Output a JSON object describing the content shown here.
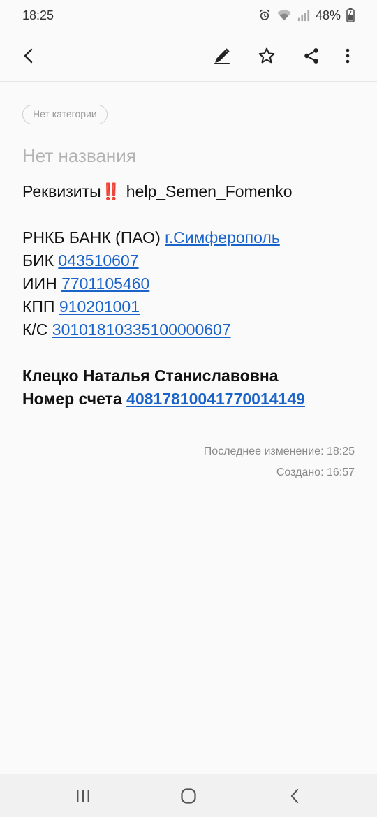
{
  "status_bar": {
    "time": "18:25",
    "battery_percent": "48%",
    "icons": [
      "alarm-icon",
      "wifi-icon",
      "signal-icon",
      "battery-charging-icon"
    ]
  },
  "toolbar": {
    "icons": [
      "back-arrow-icon",
      "pencil-icon",
      "star-icon",
      "share-icon",
      "more-vertical-icon"
    ]
  },
  "note": {
    "category": "Нет категории",
    "title": "Нет названия",
    "line1_prefix": "Реквизиты",
    "line1_emoji": "‼️",
    "line1_suffix": " help_Semen_Fomenko",
    "bank_prefix": "РНКБ БАНК (ПАО) ",
    "bank_city": "г.Симферополь",
    "bik_label": "БИК ",
    "bik_value": "043510607",
    "inn_label": "ИИН ",
    "inn_value": "7701105460",
    "kpp_label": "КПП ",
    "kpp_value": "910201001",
    "ks_label": "К/С ",
    "ks_value": "30101810335100000607",
    "holder": "Клецко Наталья Станиславовна",
    "account_label": "Номер счета ",
    "account_value": "40817810041770014149"
  },
  "meta": {
    "modified": "Последнее изменение: 18:25",
    "created": "Создано: 16:57"
  },
  "nav_bar": {
    "icons": [
      "recent-apps-icon",
      "home-icon",
      "back-icon"
    ]
  },
  "colors": {
    "link": "#1a63c9",
    "background": "#fafafa",
    "muted": "#b3b3b3"
  }
}
